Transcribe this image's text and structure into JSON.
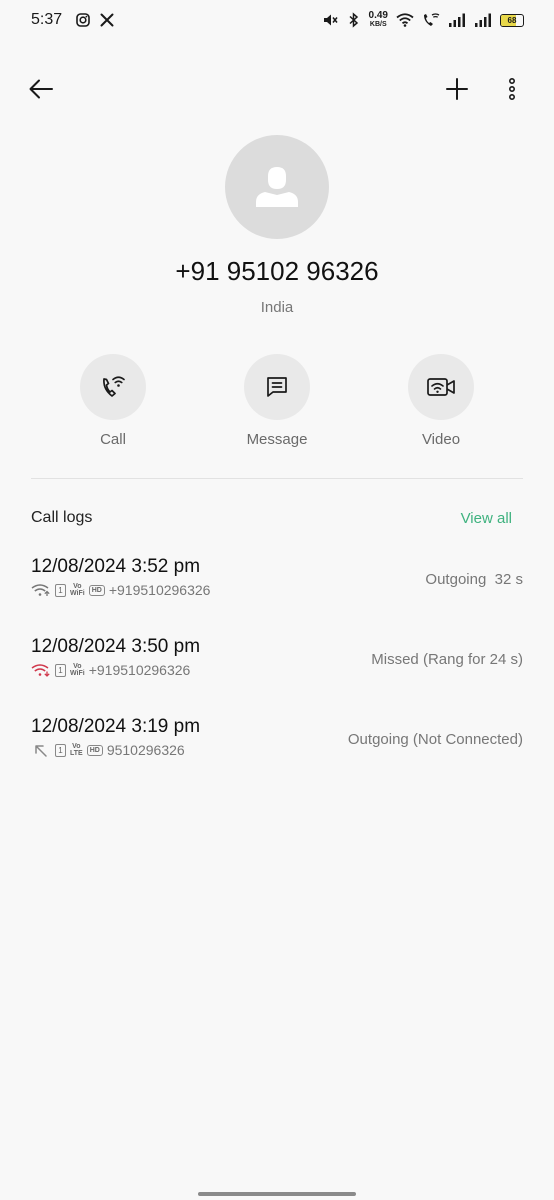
{
  "status_bar": {
    "time": "5:37",
    "net_speed_value": "0.49",
    "net_speed_unit": "KB/S",
    "battery": "68",
    "battery_level_percent": 68,
    "icons": [
      "instagram-icon",
      "x-icon",
      "mute-icon",
      "bluetooth-icon",
      "wifi-icon",
      "wifi-calling-icon",
      "signal-icon",
      "signal-icon",
      "battery-icon"
    ]
  },
  "app_bar": {
    "icons": [
      "back-arrow-icon",
      "plus-icon",
      "more-vertical-icon"
    ]
  },
  "contact": {
    "number": "+91 95102 96326",
    "region": "India",
    "avatar_icon": "person-icon"
  },
  "actions": [
    {
      "label": "Call",
      "icon": "wifi-call-icon"
    },
    {
      "label": "Message",
      "icon": "message-icon"
    },
    {
      "label": "Video",
      "icon": "wifi-video-icon"
    }
  ],
  "call_logs": {
    "title": "Call logs",
    "view_all": "View all",
    "entries": [
      {
        "datetime": "12/08/2024 3:52 pm",
        "sim": "1",
        "vo_top": "Vo",
        "vo_bottom": "WiFi",
        "hd": "HD",
        "number": "+919510296326",
        "status": "Outgoing  32 s",
        "direction": "outgoing-wifi"
      },
      {
        "datetime": "12/08/2024 3:50 pm",
        "sim": "1",
        "vo_top": "Vo",
        "vo_bottom": "WiFi",
        "hd": "",
        "number": "+919510296326",
        "status": "Missed (Rang for 24 s)",
        "direction": "missed-wifi"
      },
      {
        "datetime": "12/08/2024 3:19 pm",
        "sim": "1",
        "vo_top": "Vo",
        "vo_bottom": "LTE",
        "hd": "HD",
        "number": "9510296326",
        "status": "Outgoing (Not Connected)",
        "direction": "outgoing"
      }
    ]
  },
  "colors": {
    "accent": "#3fb27f",
    "missed": "#d0384c",
    "background": "#f8f8f8"
  }
}
